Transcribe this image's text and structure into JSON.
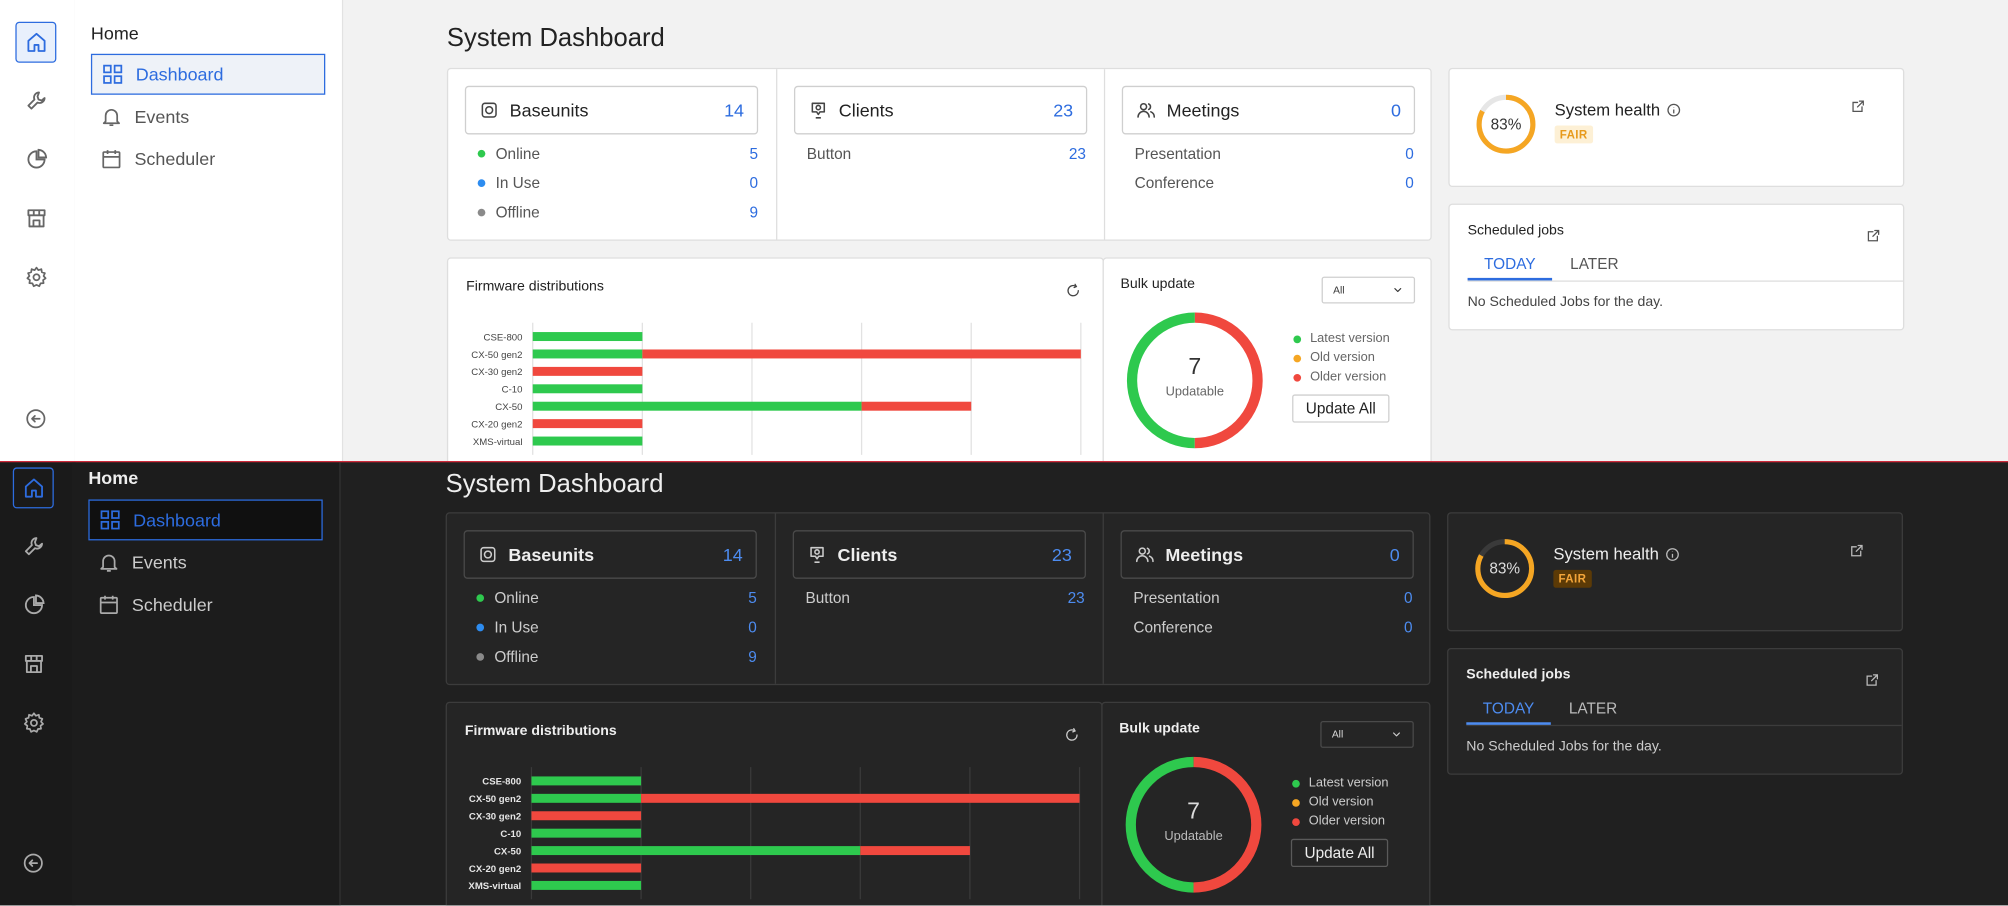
{
  "nav": {
    "section": "Home",
    "items": [
      {
        "label": "Dashboard",
        "icon": "grid-icon"
      },
      {
        "label": "Events",
        "icon": "bell-icon"
      },
      {
        "label": "Scheduler",
        "icon": "calendar-icon"
      }
    ],
    "rail_icons": [
      "home-icon",
      "wrench-icon",
      "pie-chart-icon",
      "store-icon",
      "gear-icon",
      "collapse-arrow-icon"
    ]
  },
  "page": {
    "title": "System Dashboard"
  },
  "stats": {
    "baseunits": {
      "label": "Baseunits",
      "count": "14",
      "rows": [
        {
          "label": "Online",
          "value": "5",
          "color": "#2ec94e"
        },
        {
          "label": "In Use",
          "value": "0",
          "color": "#2d8cf0"
        },
        {
          "label": "Offline",
          "value": "9",
          "color": "#8a8a8a"
        }
      ]
    },
    "clients": {
      "label": "Clients",
      "count": "23",
      "rows": [
        {
          "label": "Button",
          "value": "23"
        }
      ]
    },
    "meetings": {
      "label": "Meetings",
      "count": "0",
      "rows": [
        {
          "label": "Presentation",
          "value": "0"
        },
        {
          "label": "Conference",
          "value": "0"
        }
      ]
    }
  },
  "health": {
    "title": "System health",
    "percent_label": "83%",
    "percent": 83,
    "status": "FAIR",
    "ring_color": "#f5a623"
  },
  "jobs": {
    "title": "Scheduled jobs",
    "tabs": [
      "TODAY",
      "LATER"
    ],
    "active_tab": "TODAY",
    "empty": "No Scheduled Jobs for the day."
  },
  "firmware": {
    "title": "Firmware distributions",
    "chart_data": {
      "type": "bar",
      "orientation": "horizontal",
      "stacked": true,
      "categories": [
        "CSE-800",
        "CX-50 gen2",
        "CX-30 gen2",
        "C-10",
        "CX-50",
        "CX-20 gen2",
        "XMS-virtual"
      ],
      "series": [
        {
          "color": "#2ec94e",
          "values": [
            1,
            1,
            0,
            1,
            3,
            0,
            1
          ]
        },
        {
          "color": "#f0483e",
          "values": [
            0,
            4,
            1,
            0,
            1,
            1,
            0
          ]
        }
      ],
      "xticks": [
        "0",
        "1",
        "2",
        "3",
        "4",
        "5"
      ],
      "xlim": [
        0,
        5
      ],
      "grid": true
    }
  },
  "bulk": {
    "title": "Bulk update",
    "filter": "All",
    "total": "7",
    "total_label": "Updatable",
    "button": "Update All",
    "chart_data": {
      "type": "pie",
      "donut": true,
      "slices": [
        {
          "label": "Latest version",
          "value": 3.5,
          "color": "#2ec94e"
        },
        {
          "label": "Old version",
          "value": 0,
          "color": "#f5a623"
        },
        {
          "label": "Older version",
          "value": 3.5,
          "color": "#f0483e"
        }
      ]
    }
  }
}
